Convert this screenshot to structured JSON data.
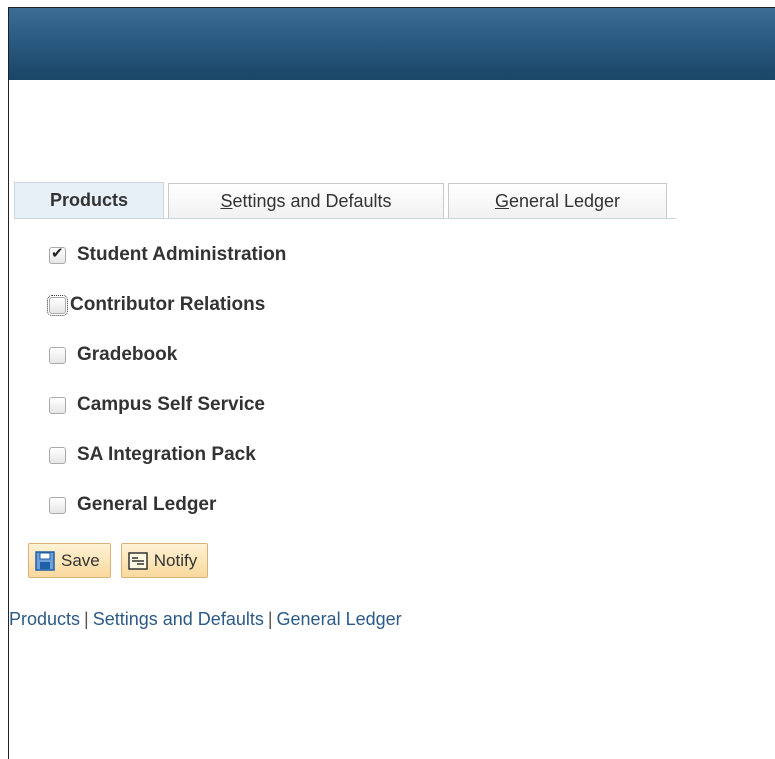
{
  "tabs": [
    {
      "label": "Products",
      "active": true
    },
    {
      "accesskey": "S",
      "rest": "ettings and Defaults",
      "active": false
    },
    {
      "accesskey": "G",
      "rest": "eneral Ledger",
      "active": false
    }
  ],
  "products": [
    {
      "label": "Student Administration",
      "checked": true
    },
    {
      "label": "Contributor Relations",
      "checked": false,
      "focused": true
    },
    {
      "label": "Gradebook",
      "checked": false
    },
    {
      "label": "Campus Self Service",
      "checked": false
    },
    {
      "label": "SA Integration Pack",
      "checked": false
    },
    {
      "label": "General Ledger",
      "checked": false
    }
  ],
  "buttons": {
    "save_label": "Save",
    "notify_label": "Notify"
  },
  "links": {
    "products": "Products",
    "settings": "Settings and Defaults",
    "general_ledger": "General Ledger",
    "separator": "|"
  },
  "colors": {
    "header": "#2a5b81",
    "link": "#2b5a86",
    "button_bg": "#f9d99c"
  }
}
